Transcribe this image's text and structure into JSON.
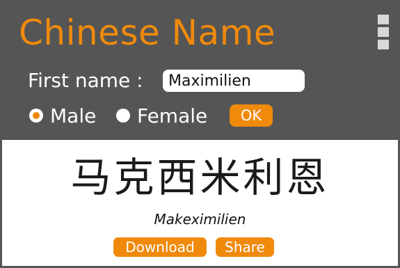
{
  "app": {
    "title": "Chinese Name"
  },
  "form": {
    "first_name_label": "First name :",
    "first_name_value": "Maximilien",
    "gender": {
      "male_label": "Male",
      "female_label": "Female",
      "selected": "Male"
    },
    "ok_label": "OK"
  },
  "result": {
    "chinese_name": "马克西米利恩",
    "romanization": "Makeximilien",
    "download_label": "Download",
    "share_label": "Share"
  },
  "colors": {
    "accent": "#f08a0c",
    "header_bg": "#555555",
    "result_bg": "#ffffff"
  },
  "icons": {
    "menu": "hamburger-menu-icon"
  }
}
